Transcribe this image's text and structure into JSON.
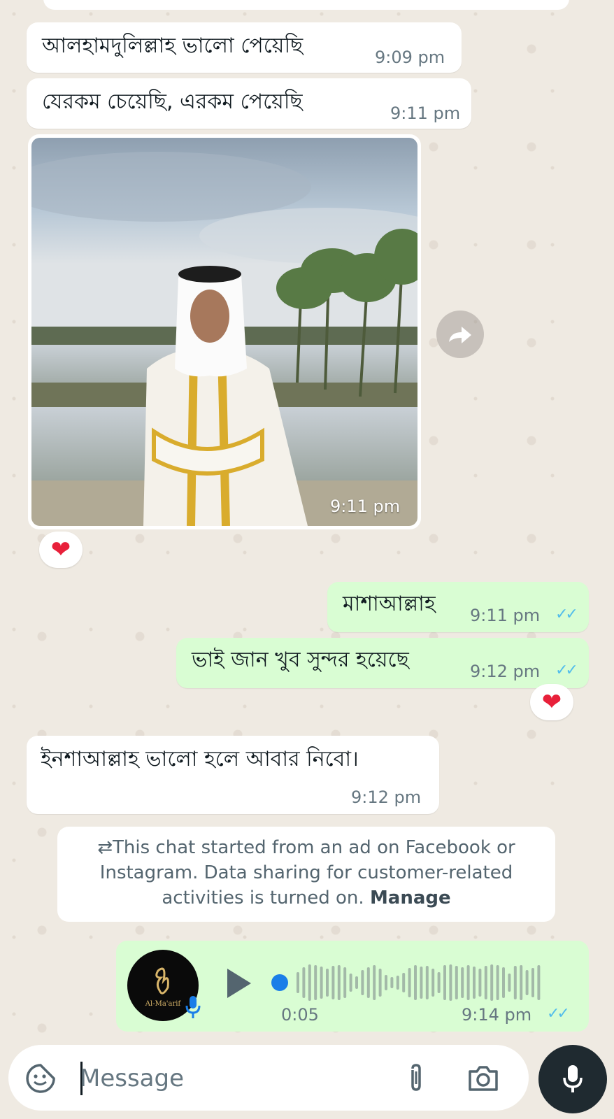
{
  "messages": [
    {
      "text": "আলহামদুলিল্লাহ ভালো পেয়েছি",
      "time": "9:09 pm"
    },
    {
      "text": "যেরকম চেয়েছি, এরকম পেয়েছি",
      "time": "9:11 pm"
    },
    {
      "photo_time": "9:11 pm"
    },
    {
      "text": "মাশাআল্লাহ",
      "time": "9:11 pm",
      "ticks": "✓✓"
    },
    {
      "text": "ভাই জান খুব সুন্দর হয়েছে",
      "time": "9:12 pm",
      "ticks": "✓✓"
    },
    {
      "text": "ইনশাআল্লাহ ভালো হলে আবার নিবো।",
      "time": "9:12 pm"
    }
  ],
  "reactions": {
    "photo": "❤",
    "outgoing": "❤"
  },
  "system_note": {
    "line1": "⇄This chat started from an ad on Facebook or",
    "line2": "Instagram. Data sharing for customer-related",
    "line3": "activities is turned on.",
    "manage": "Manage"
  },
  "voice_message": {
    "duration": "0:05",
    "time": "9:14 pm",
    "ticks": "✓✓",
    "avatar_text": "Al-Ma'arif",
    "progress": 0.0
  },
  "composer": {
    "placeholder": "Message"
  },
  "colors": {
    "incoming": "#ffffff",
    "outgoing": "#d9fdd3",
    "read_ticks": "#53bdeb",
    "background": "#efeae2",
    "voice_dot": "#1a7ee8"
  },
  "icons": [
    "forward-icon",
    "sticker-icon",
    "attach-icon",
    "camera-icon",
    "mic-icon",
    "play-icon"
  ]
}
